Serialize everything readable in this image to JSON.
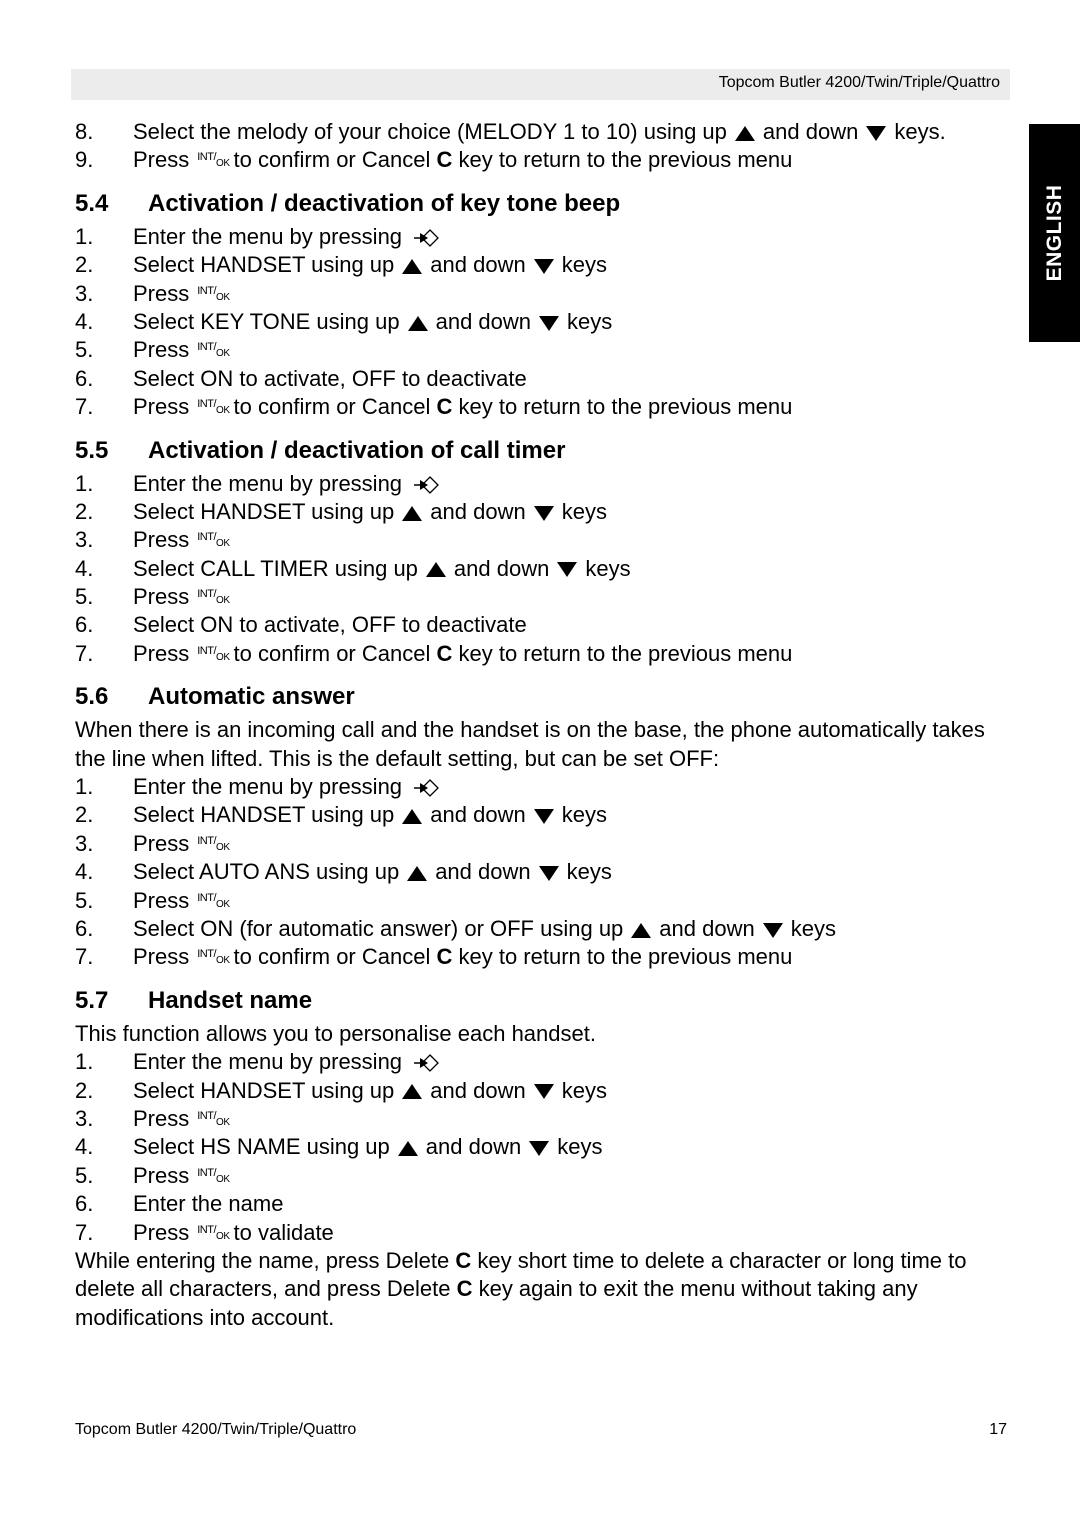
{
  "header": {
    "title": "Topcom Butler 4200/Twin/Triple/Quattro"
  },
  "side_tab": {
    "label": "ENGLISH"
  },
  "icons": {
    "up": "up-arrow-key",
    "down": "down-arrow-key",
    "menu": "menu-key",
    "ok": "int-ok-key",
    "ok_text_top": "INT",
    "ok_text_bottom": "OK"
  },
  "intro": {
    "items": [
      {
        "n": "8.",
        "a": "Select the melody of your choice (MELODY 1 to 10) using up",
        "b": "and down",
        "c": "keys."
      },
      {
        "n": "9.",
        "a": "Press",
        "b": "to confirm or Cancel",
        "c": "C",
        "d": "key  to return to the previous menu"
      }
    ]
  },
  "sections": [
    {
      "num": "5.4",
      "title": "Activation / deactivation of key tone beep",
      "s1": "Enter the menu by pressing",
      "s2a": "Select HANDSET using up",
      "s2b": "and down",
      "s2c": "keys",
      "s3": "Press",
      "s4a": "Select KEY TONE using up",
      "s4b": "and down",
      "s4c": "keys",
      "s5": "Press",
      "s6": "Select ON to activate, OFF to deactivate",
      "s7a": "Press",
      "s7b": "to confirm or Cancel",
      "s7c": "C",
      "s7d": "key  to return to the previous menu"
    },
    {
      "num": "5.5",
      "title": "Activation / deactivation of call timer",
      "s1": "Enter the menu by pressing",
      "s2a": "Select HANDSET using up",
      "s2b": "and down",
      "s2c": "keys",
      "s3": "Press",
      "s4a": "Select CALL TIMER using up",
      "s4b": "and down",
      "s4c": "keys",
      "s5": "Press",
      "s6": "Select ON to activate, OFF to deactivate",
      "s7a": "Press",
      "s7b": "to confirm or Cancel",
      "s7c": "C",
      "s7d": "key  to return to the previous menu"
    },
    {
      "num": "5.6",
      "title": "Automatic answer",
      "para": "When there is an incoming call and the handset is on the base, the phone automatically takes the line when lifted. This is the default setting, but can be set OFF:",
      "s1": "Enter the menu by pressing",
      "s2a": "Select HANDSET using up",
      "s2b": "and down",
      "s2c": "keys",
      "s3": "Press",
      "s4a": "Select AUTO ANS using up",
      "s4b": "and down",
      "s4c": "keys",
      "s5": "Press",
      "s6a": "Select ON (for automatic answer) or OFF using up",
      "s6b": "and down",
      "s6c": "keys",
      "s7a": "Press",
      "s7b": "to confirm or Cancel",
      "s7c": "C",
      "s7d": "key  to return to the previous menu"
    },
    {
      "num": "5.7",
      "title": "Handset name",
      "para": "This function allows you to personalise each handset.",
      "s1": "Enter the menu by pressing",
      "s2a": "Select HANDSET using up",
      "s2b": "and down",
      "s2c": "keys",
      "s3": "Press",
      "s4a": "Select  HS NAME using up",
      "s4b": "and down",
      "s4c": "keys",
      "s5": "Press",
      "s6": "Enter the name",
      "s7a": "Press",
      "s7b": "to validate",
      "after_a": "While entering the name, press Delete",
      "after_b": "C",
      "after_c": "key short time to delete a character or long time to delete all characters, and press Delete",
      "after_d": "C",
      "after_e": "key again to exit the menu without taking any modifications into account."
    }
  ],
  "nums": [
    "1.",
    "2.",
    "3.",
    "4.",
    "5.",
    "6.",
    "7."
  ],
  "footer": {
    "title": "Topcom Butler 4200/Twin/Triple/Quattro",
    "page": "17"
  }
}
